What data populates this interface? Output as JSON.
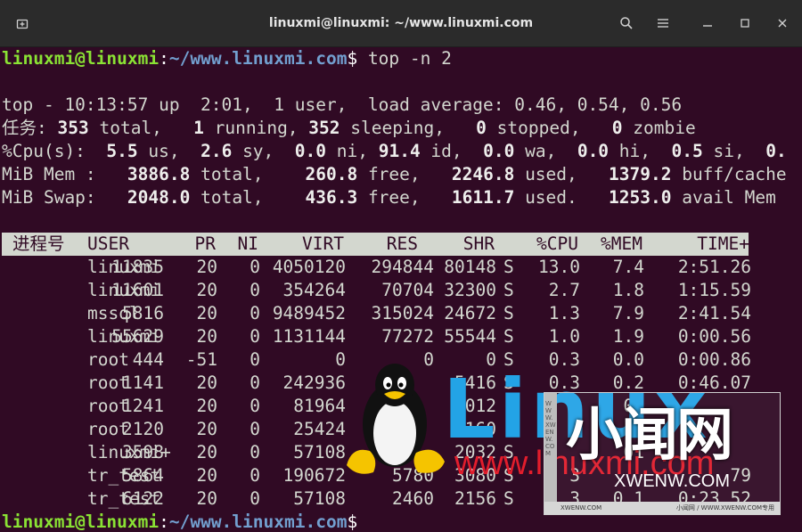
{
  "window": {
    "title": "linuxmi@linuxmi: ~/www.linuxmi.com",
    "icons": [
      "new-tab-icon",
      "search-icon",
      "hamburger-menu-icon",
      "minimize-icon",
      "maximize-icon",
      "close-icon"
    ]
  },
  "prompt": {
    "user_host": "linuxmi@linuxmi",
    "colon": ":",
    "path": "~/www.linuxmi.com",
    "dollar": "$",
    "command": " top -n 2"
  },
  "summary": {
    "uptime": "top - 10:13:57 up  2:01,  1 user,  load average: 0.46, 0.54, 0.56",
    "tasks": {
      "label": "任务:",
      "total": "353",
      "running": "1",
      "sleeping": "352",
      "stopped": "0",
      "zombie": "0"
    },
    "cpu": {
      "label": "%Cpu(s):",
      "us": "5.5",
      "sy": "2.6",
      "ni": "0.0",
      "id": "91.4",
      "wa": "0.0",
      "hi": "0.0",
      "si": "0.5",
      "st": "0."
    },
    "mem": {
      "label": "MiB Mem :",
      "total": "3886.8",
      "free": "260.8",
      "used": "2246.8",
      "buff": "1379.2",
      "buff_label": "buff/cache"
    },
    "swap": {
      "label": "MiB Swap:",
      "total": "2048.0",
      "free": "436.3",
      "used": "1611.7",
      "avail": "1253.0",
      "avail_label": "avail Mem"
    }
  },
  "table": {
    "headers": [
      "进程号",
      "USER",
      "PR",
      "NI",
      "VIRT",
      "RES",
      "SHR",
      "",
      "%CPU",
      "%MEM",
      "TIME+"
    ],
    "rows": [
      [
        "11835",
        "linuxmi",
        "20",
        "0",
        "4050120",
        "294844",
        "80148",
        "S",
        "13.0",
        "7.4",
        "2:51.26"
      ],
      [
        "11601",
        "linuxmi",
        "20",
        "0",
        "354264",
        "70704",
        "32300",
        "S",
        "2.7",
        "1.8",
        "1:15.59"
      ],
      [
        "5816",
        "mssql",
        "20",
        "0",
        "9489452",
        "315024",
        "24672",
        "S",
        "1.3",
        "7.9",
        "2:41.54"
      ],
      [
        "55629",
        "linuxmi",
        "20",
        "0",
        "1131144",
        "77272",
        "55544",
        "S",
        "1.0",
        "1.9",
        "0:00.56"
      ],
      [
        "444",
        "root",
        "-51",
        "0",
        "0",
        "0",
        "0",
        "S",
        "0.3",
        "0.0",
        "0:00.86"
      ],
      [
        "1141",
        "root",
        "20",
        "0",
        "242936",
        "",
        "5416",
        "S",
        "0.3",
        "0.2",
        "0:46.07"
      ],
      [
        "1241",
        "root",
        "20",
        "0",
        "81964",
        "",
        "012",
        "",
        "",
        "01",
        ""
      ],
      [
        "2120",
        "root",
        "20",
        "0",
        "25424",
        "",
        "160",
        "",
        "",
        "",
        ""
      ],
      [
        "3598",
        "linuxmi+",
        "20",
        "0",
        "57108",
        "",
        "2032",
        "S",
        "",
        "01",
        ""
      ],
      [
        "5864",
        "tr_test",
        "20",
        "0",
        "190672",
        "5780",
        "3080",
        "S",
        "3",
        "",
        "79"
      ],
      [
        "6122",
        "tr_test",
        "20",
        "0",
        "57108",
        "2460",
        "2156",
        "S",
        "3",
        "0.1",
        "0:23.52"
      ]
    ]
  },
  "watermark": {
    "brand": "Linux",
    "site": "www.linuxmi.com",
    "cn_name": "小闻网",
    "domain": "XWENW.COM",
    "small_left": "XWENW.COM",
    "small_right": "小闻网 / WWW.XWENW.COM专用",
    "side": "WWW.XWENW.COM"
  }
}
